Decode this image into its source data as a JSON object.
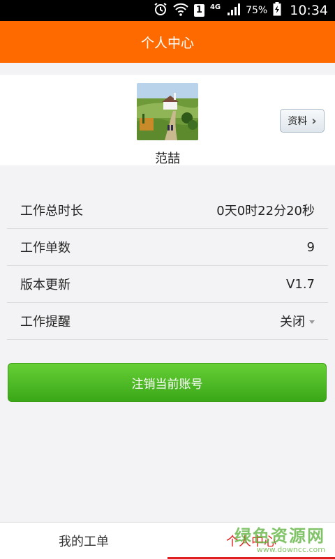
{
  "status_bar": {
    "network": "4G",
    "battery": "75%",
    "time": "10:34",
    "sim": "1"
  },
  "header": {
    "title": "个人中心"
  },
  "profile": {
    "name": "范喆",
    "profile_button": "资料"
  },
  "info_rows": [
    {
      "label": "工作总时长",
      "value": "0天0时22分20秒"
    },
    {
      "label": "工作单数",
      "value": "9"
    },
    {
      "label": "版本更新",
      "value": "V1.7"
    },
    {
      "label": "工作提醒",
      "value": "关闭"
    }
  ],
  "logout_button": "注销当前账号",
  "tabs": [
    {
      "label": "我的工单",
      "active": false
    },
    {
      "label": "个人中心",
      "active": true
    }
  ],
  "watermark": {
    "line1": "绿色资源网",
    "line2": "www.downcc.com"
  },
  "colors": {
    "header": "#ff6a00",
    "button": "#3aa718",
    "active_tab": "#e02020"
  }
}
